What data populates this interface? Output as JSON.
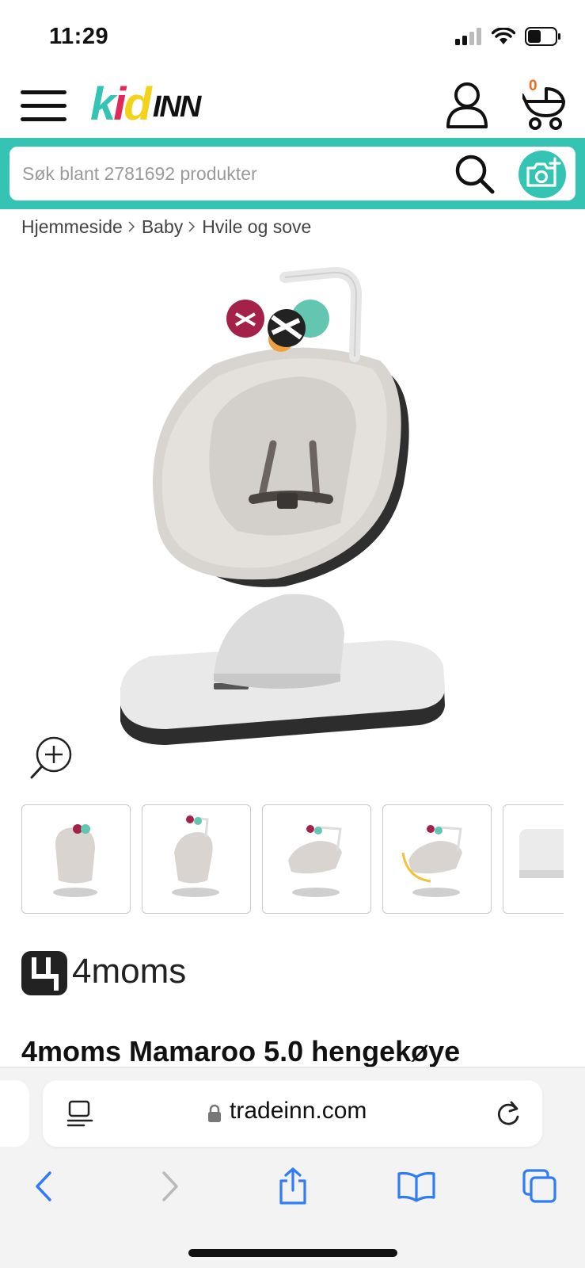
{
  "status_bar": {
    "time": "11:29"
  },
  "header": {
    "logo_kid": "kid",
    "logo_inn": "INN",
    "cart_count": "0"
  },
  "search": {
    "placeholder": "Søk blant 2781692 produkter"
  },
  "breadcrumb": [
    "Hjemmeside",
    "Baby",
    "Hvile og sove"
  ],
  "gallery": {
    "thumbnail_count": 5
  },
  "brand": {
    "name": "4moms"
  },
  "product": {
    "title": "4moms Mamaroo 5.0 hengekøye"
  },
  "browser": {
    "url": "tradeinn.com"
  },
  "colors": {
    "accent": "#35c3b4",
    "cart_badge": "#f26b1d",
    "safari_blue": "#2f7cf6",
    "logo_k": "#35c3b4",
    "logo_i": "#e02a5a",
    "logo_d": "#f2d21a"
  }
}
